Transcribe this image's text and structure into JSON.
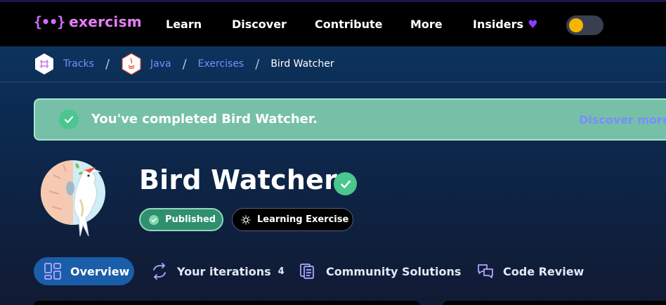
{
  "nav": {
    "logo_mark": "{••}",
    "logo_text": "exercism",
    "items": [
      {
        "label": "Learn"
      },
      {
        "label": "Discover"
      },
      {
        "label": "Contribute"
      },
      {
        "label": "More"
      },
      {
        "label": "Insiders"
      }
    ],
    "insiders_icon": "purple-heart",
    "theme_toggle": {
      "state": "on",
      "knob_color": "#f7b500"
    }
  },
  "breadcrumb": {
    "tracks": "Tracks",
    "java": "Java",
    "exercises": "Exercises",
    "current": "Bird Watcher",
    "separator": "/"
  },
  "banner": {
    "message": "You've completed Bird Watcher.",
    "link": "Discover more e"
  },
  "exercise": {
    "title": "Bird Watcher",
    "status": "Published",
    "type": "Learning Exercise"
  },
  "tabs": [
    {
      "label": "Overview",
      "active": true
    },
    {
      "label": "Your iterations",
      "count": "4"
    },
    {
      "label": "Community Solutions"
    },
    {
      "label": "Code Review"
    }
  ],
  "colors": {
    "accent_link": "#7b8cff",
    "success": "#4ac68f",
    "brand": "#e77ef8"
  }
}
